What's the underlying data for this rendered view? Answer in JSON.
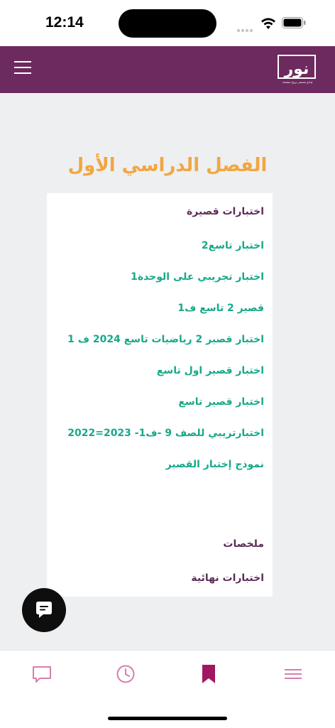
{
  "status_bar": {
    "time": "12:14"
  },
  "header": {
    "logo_text": "نور",
    "logo_tagline": "إبداع مستمر بروح منفتحة"
  },
  "page": {
    "title": "الفصل الدراسي الأول"
  },
  "sections": [
    {
      "id": "short",
      "label": "اختبارات قصيرة",
      "type": "heading"
    },
    {
      "label": "اختبار تاسع2",
      "type": "link"
    },
    {
      "label": "اختبار تجريبي على الوحدة1",
      "type": "link"
    },
    {
      "label": "قصير 2 تاسع ف1",
      "type": "link"
    },
    {
      "label": "اختبار قصير 2 رياضيات تاسع 2024 ف 1",
      "type": "link"
    },
    {
      "label": "اختبار قصير اول تاسع",
      "type": "link"
    },
    {
      "label": "اختبار قصير تاسع",
      "type": "link"
    },
    {
      "label": "اختبارتريبي للصف 9 -ف1- 2023=2022",
      "type": "link"
    },
    {
      "label": "نموذج إختبار القصير",
      "type": "link"
    },
    {
      "id": "summaries",
      "label": "ملخصات",
      "type": "heading"
    },
    {
      "id": "finals",
      "label": "اختبارات نهائية",
      "type": "heading"
    }
  ],
  "icons": {
    "menu": "hamburger-icon",
    "chat_fab": "chat-bubble-icon",
    "tab_chat": "chat-icon",
    "tab_history": "clock-icon",
    "tab_bookmark": "bookmark-icon",
    "tab_menu": "menu-icon"
  },
  "colors": {
    "header": "#6d2a5e",
    "title": "#f2a641",
    "heading": "#5b2d57",
    "link": "#18a88a",
    "tab_icon": "#d67fae",
    "tab_active": "#a0185f"
  }
}
